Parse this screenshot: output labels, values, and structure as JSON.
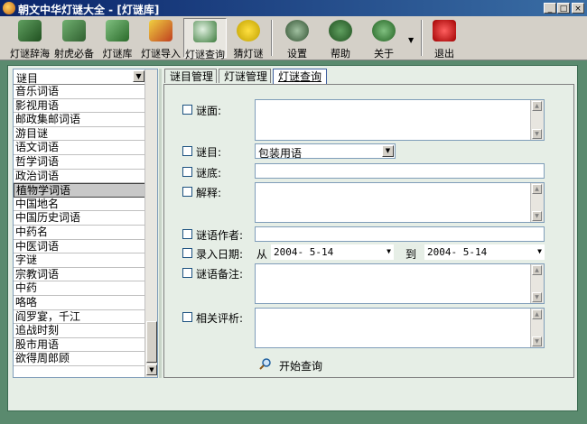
{
  "window": {
    "title": "朝文中华灯谜大全 - [灯谜库]",
    "controls": [
      "_",
      "□",
      "×"
    ]
  },
  "toolbar": {
    "buttons": [
      {
        "label": "灯谜辞海",
        "icon": "book-icon"
      },
      {
        "label": "射虎必备",
        "icon": "book-icon"
      },
      {
        "label": "灯谜库",
        "icon": "refresh-book-icon"
      },
      {
        "label": "灯谜导入",
        "icon": "import-icon"
      },
      {
        "label": "灯谜查询",
        "icon": "search-icon"
      },
      {
        "label": "猜灯谜",
        "icon": "smiley-icon"
      },
      {
        "label": "设置",
        "icon": "gear-icon"
      },
      {
        "label": "帮助",
        "icon": "help-icon"
      },
      {
        "label": "关于",
        "icon": "info-icon"
      },
      {
        "label": "退出",
        "icon": "power-icon"
      }
    ]
  },
  "left": {
    "combo_value": "谜目",
    "items": [
      "音乐词语",
      "影视用语",
      "邮政集邮词语",
      "游目谜",
      "语文词语",
      "哲学词语",
      "政治词语",
      "植物学词语",
      "中国地名",
      "中国历史词语",
      "中药名",
      "中医词语",
      "字谜",
      "宗教词语",
      "中药",
      "咯咯",
      "阎罗宴，千江",
      "追战时刻",
      "股市用语",
      "欲得周郎顾"
    ],
    "selected_index": 7
  },
  "tabs": [
    {
      "label": "谜目管理"
    },
    {
      "label": "灯谜管理"
    },
    {
      "label": "灯谜查询"
    }
  ],
  "form": {
    "riddle_label": "谜面:",
    "category_label": "谜目:",
    "category_value": "包装用语",
    "answer_label": "谜底:",
    "explain_label": "解释:",
    "author_label": "谜语作者:",
    "date_label": "录入日期:",
    "from_label": "从",
    "from_date": "2004- 5-14",
    "to_label": "到",
    "to_date": "2004- 5-14",
    "remark_label": "谜语备注:",
    "comment_label": "相关评析:",
    "search_label": "开始查询"
  }
}
